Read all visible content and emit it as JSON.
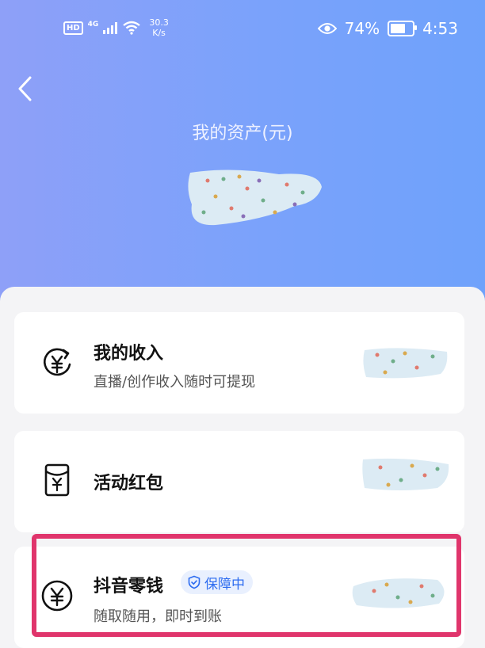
{
  "status_bar": {
    "hd": "HD",
    "network": "4G",
    "speed_value": "30.3",
    "speed_unit": "K/s",
    "battery_percent": "74%",
    "time": "4:53"
  },
  "header": {
    "title": "我的资产(元)"
  },
  "cards": [
    {
      "title": "我的收入",
      "subtitle": "直播/创作收入随时可提现",
      "icon": "income-yen-icon"
    },
    {
      "title": "活动红包",
      "subtitle": "",
      "icon": "red-packet-icon"
    },
    {
      "title": "抖音零钱",
      "subtitle": "随取随用，即时到账",
      "badge": "保障中",
      "icon": "yen-circle-icon"
    }
  ],
  "colors": {
    "header_gradient_start": "#8ea0f8",
    "header_gradient_end": "#6fa2fb",
    "badge_text": "#2d6cf0",
    "badge_bg": "#e9f0fe",
    "highlight_border": "#e0356c"
  }
}
